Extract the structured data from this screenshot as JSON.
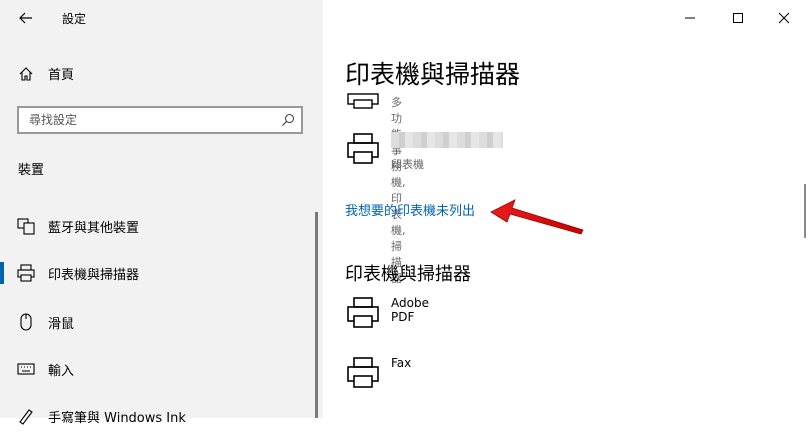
{
  "window": {
    "title": "設定"
  },
  "sidebar": {
    "home_label": "首頁",
    "search_placeholder": "尋找設定",
    "section_heading": "裝置",
    "items": [
      {
        "label": "藍牙與其他裝置",
        "icon": "bluetooth-devices-icon",
        "active": false
      },
      {
        "label": "印表機與掃描器",
        "icon": "printer-icon",
        "active": true
      },
      {
        "label": "滑鼠",
        "icon": "mouse-icon",
        "active": false
      },
      {
        "label": "輸入",
        "icon": "keyboard-icon",
        "active": false
      },
      {
        "label": "手寫筆與 Windows Ink",
        "icon": "pen-icon",
        "active": false
      }
    ]
  },
  "main": {
    "page_title": "印表機與掃描器",
    "top_devices": [
      {
        "name": "",
        "sub": "多功能事務機, 印表機, 掃描器"
      },
      {
        "name": "",
        "sub": "印表機",
        "blurred": true
      }
    ],
    "not_listed_link": "我想要的印表機未列出",
    "printers_heading": "印表機與掃描器",
    "printers": [
      {
        "name": "Adobe PDF"
      },
      {
        "name": "Fax"
      }
    ]
  },
  "colors": {
    "accent": "#0063b1",
    "sidebar_bg": "#f2f2f2",
    "annotation_arrow": "#e81e1e"
  }
}
